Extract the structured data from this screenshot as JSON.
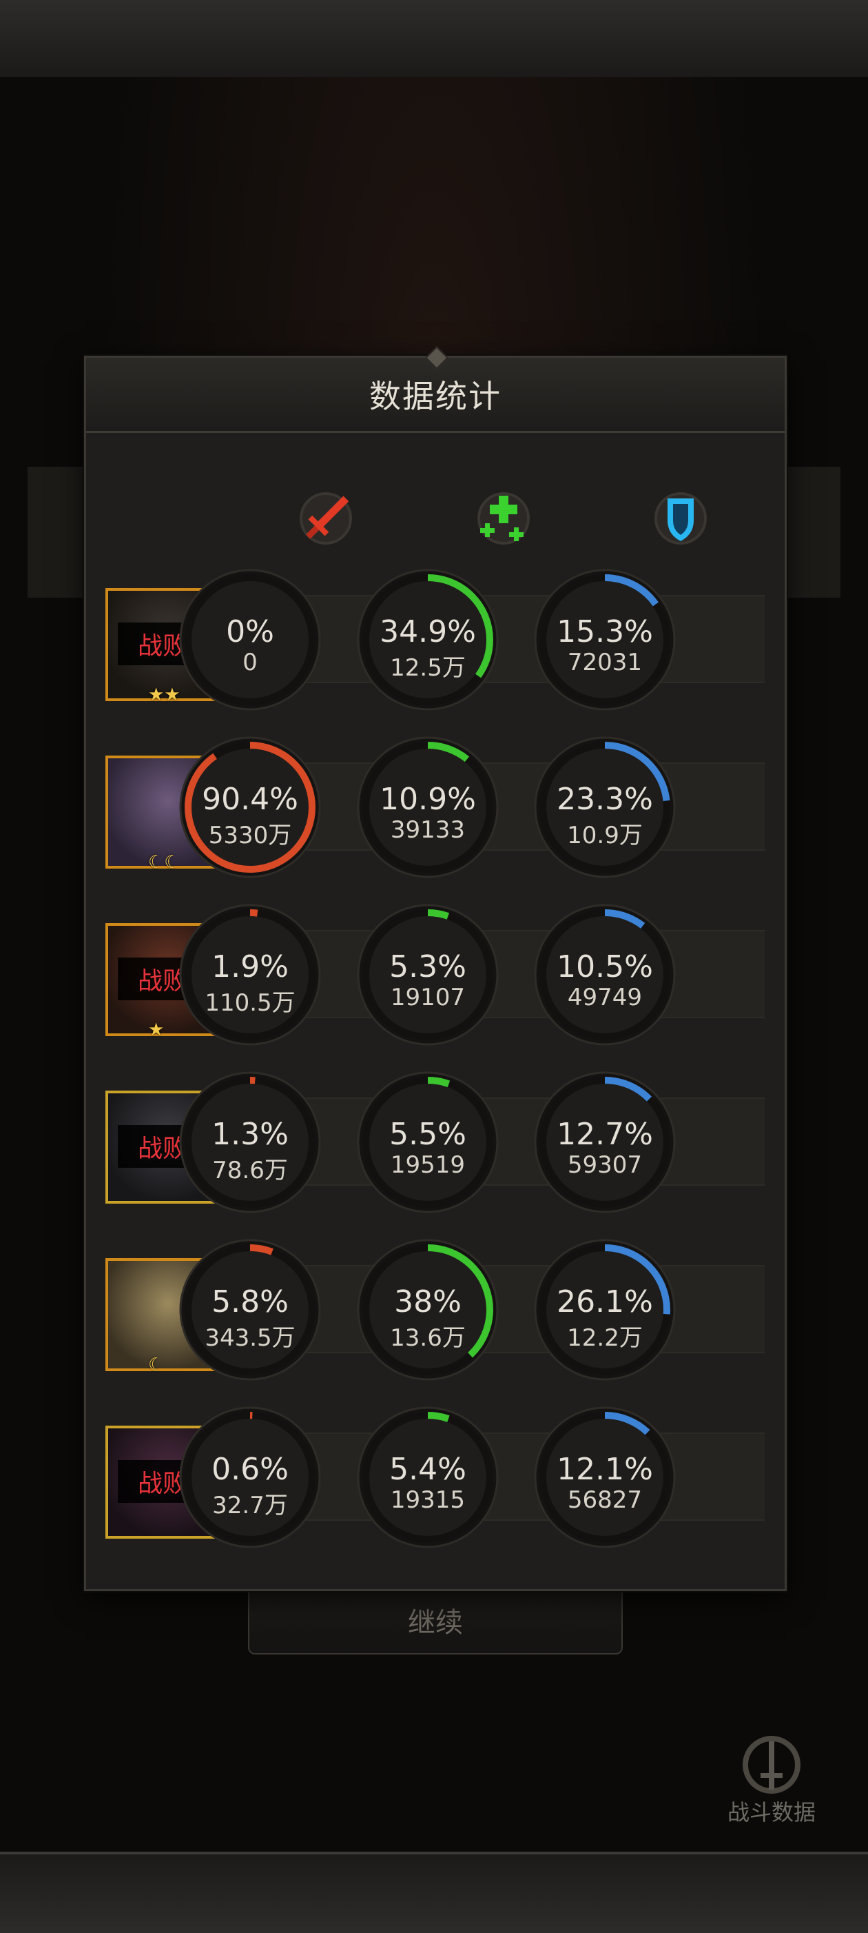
{
  "panel": {
    "title": "数据统计",
    "columns": [
      {
        "icon": "sword-icon",
        "color": "#e23a25"
      },
      {
        "icon": "healing-crosses-icon",
        "color": "#3bd12e"
      },
      {
        "icon": "shield-icon",
        "color": "#29b7f1"
      }
    ]
  },
  "colors": {
    "damage": "#d94b26",
    "heal": "#3cc52f",
    "shield": "#3e84d6",
    "defeat_text": "#e8333a"
  },
  "rows": [
    {
      "portrait": {
        "defeated": true,
        "status_label": "战败",
        "badge": "★★",
        "tones": [
          "#3a3530",
          "#1a1612"
        ],
        "frame": "#d08a19"
      },
      "damage": {
        "pct": 0,
        "pct_label": "0%",
        "amount": "0"
      },
      "heal": {
        "pct": 34.9,
        "pct_label": "34.9%",
        "amount": "12.5万"
      },
      "shield": {
        "pct": 15.3,
        "pct_label": "15.3%",
        "amount": "72031"
      }
    },
    {
      "portrait": {
        "defeated": false,
        "status_label": "",
        "badge": "☾☾",
        "tones": [
          "#6e5a7c",
          "#2c2436"
        ],
        "frame": "#d08a19"
      },
      "damage": {
        "pct": 90.4,
        "pct_label": "90.4%",
        "amount": "5330万"
      },
      "heal": {
        "pct": 10.9,
        "pct_label": "10.9%",
        "amount": "39133"
      },
      "shield": {
        "pct": 23.3,
        "pct_label": "23.3%",
        "amount": "10.9万"
      }
    },
    {
      "portrait": {
        "defeated": true,
        "status_label": "战败",
        "badge": "★",
        "tones": [
          "#6a3424",
          "#231510"
        ],
        "frame": "#d08a19"
      },
      "damage": {
        "pct": 1.9,
        "pct_label": "1.9%",
        "amount": "110.5万"
      },
      "heal": {
        "pct": 5.3,
        "pct_label": "5.3%",
        "amount": "19107"
      },
      "shield": {
        "pct": 10.5,
        "pct_label": "10.5%",
        "amount": "49749"
      }
    },
    {
      "portrait": {
        "defeated": true,
        "status_label": "战败",
        "badge": "",
        "tones": [
          "#3e3d42",
          "#17171a"
        ],
        "frame": "#c9a227"
      },
      "damage": {
        "pct": 1.3,
        "pct_label": "1.3%",
        "amount": "78.6万"
      },
      "heal": {
        "pct": 5.5,
        "pct_label": "5.5%",
        "amount": "19519"
      },
      "shield": {
        "pct": 12.7,
        "pct_label": "12.7%",
        "amount": "59307"
      }
    },
    {
      "portrait": {
        "defeated": false,
        "status_label": "",
        "badge": "☾",
        "tones": [
          "#9c8a5e",
          "#3b3222"
        ],
        "frame": "#d08a19"
      },
      "damage": {
        "pct": 5.8,
        "pct_label": "5.8%",
        "amount": "343.5万"
      },
      "heal": {
        "pct": 38,
        "pct_label": "38%",
        "amount": "13.6万"
      },
      "shield": {
        "pct": 26.1,
        "pct_label": "26.1%",
        "amount": "12.2万"
      }
    },
    {
      "portrait": {
        "defeated": true,
        "status_label": "战败",
        "badge": "",
        "tones": [
          "#4a2a3e",
          "#1a1118"
        ],
        "frame": "#c9a227"
      },
      "damage": {
        "pct": 0.6,
        "pct_label": "0.6%",
        "amount": "32.7万"
      },
      "heal": {
        "pct": 5.4,
        "pct_label": "5.4%",
        "amount": "19315"
      },
      "shield": {
        "pct": 12.1,
        "pct_label": "12.1%",
        "amount": "56827"
      }
    }
  ],
  "continue_button": {
    "label": "继续"
  },
  "battle_data_button": {
    "label": "战斗数据",
    "icon": "sword-ring-icon"
  }
}
